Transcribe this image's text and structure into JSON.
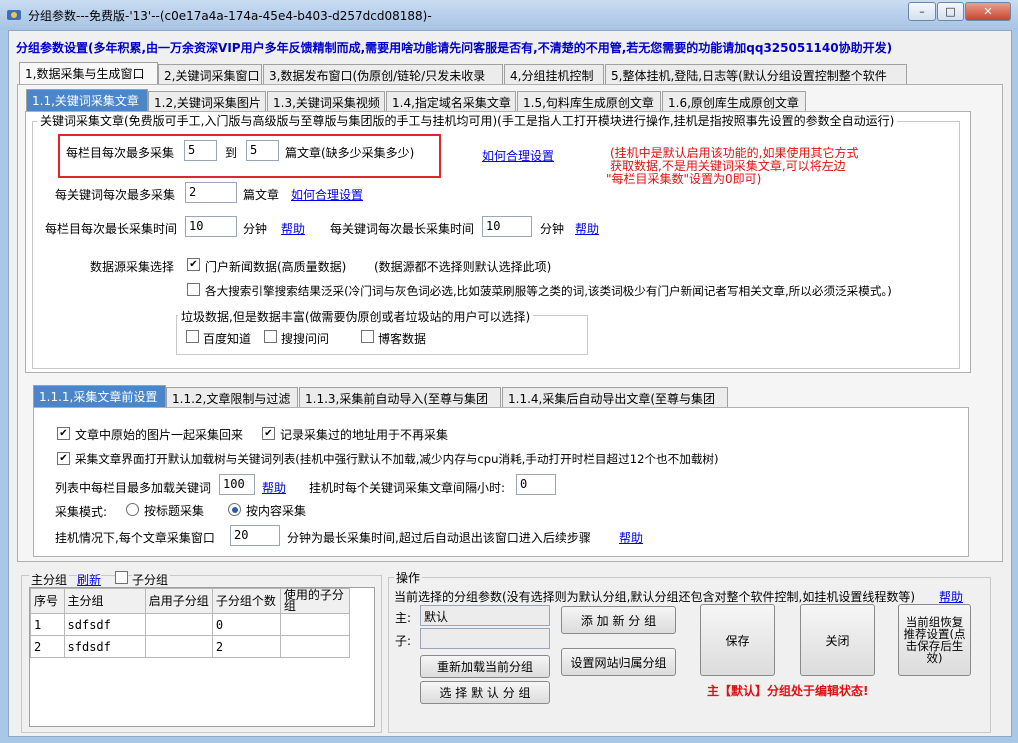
{
  "window": {
    "title": "分组参数---免费版-'13'--(c0e17a4a-174a-45e4-b403-d257dcd08188)-",
    "controls": {
      "minimize": "–",
      "maximize": "□",
      "close": "✕"
    }
  },
  "banner": "分组参数设置(多年积累,由一万余资深VIP用户多年反馈精制而成,需要用啥功能请先问客服是否有,不清楚的不用管,若无您需要的功能请加qq325051140协助开发)",
  "main_tabs": [
    "1,数据采集与生成窗口",
    "2,关键词采集窗口",
    "3,数据发布窗口(伪原创/链轮/只发未收录",
    "4,分组挂机控制",
    "5,整体挂机,登陆,日志等(默认分组设置控制整个软件"
  ],
  "sub_tabs": [
    "1.1,关键词采集文章",
    "1.2,关键词采集图片",
    "1.3,关键词采集视频",
    "1.4,指定域名采集文章",
    "1.5,句料库生成原创文章",
    "1.6,原创库生成原创文章"
  ],
  "section1": {
    "group_title": "关键词采集文章(免费版可手工,入门版与高级版与至尊版与集团版的手工与挂机均可用)(手工是指人工打开模块进行操作,挂机是指按照事先设置的参数全自动运行)",
    "per_col_label": "每栏目每次最多采集",
    "per_col_min": "5",
    "to_label": "到",
    "per_col_max": "5",
    "per_col_unit": "篇文章(缺多少采集多少)",
    "how_link": "如何合理设置",
    "red_note": [
      "(挂机中是默认启用该功能的,如果使用其它方式",
      "获取数据,不是用关键词采集文章,可以将左边",
      "\"每栏目采集数\"设置为0即可)"
    ],
    "per_kw_label": "每关键词每次最多采集",
    "per_kw_value": "2",
    "per_kw_unit": "篇文章",
    "per_kw_link": "如何合理设置",
    "col_time_label": "每栏目每次最长采集时间",
    "col_time_value": "10",
    "col_time_unit": "分钟",
    "col_time_help": "帮助",
    "kw_time_label": "每关键词每次最长采集时间",
    "kw_time_value": "10",
    "kw_time_unit": "分钟",
    "kw_time_help": "帮助",
    "source_label": "数据源采集选择",
    "source_portal": "门户新闻数据(高质量数据)",
    "source_portal_note": "(数据源都不选择则默认选择此项)",
    "source_portal_checked": true,
    "source_search": "各大搜索引擎搜索结果泛采(冷门词与灰色词必选,比如菠菜刷服等之类的词,该类词极少有门户新闻记者写相关文章,所以必须泛采模式。)",
    "source_search_checked": false,
    "junk_title": "垃圾数据,但是数据丰富(做需要伪原创或者垃圾站的用户可以选择)",
    "junk_items": [
      {
        "label": "百度知道",
        "checked": false
      },
      {
        "label": "搜搜问问",
        "checked": false
      },
      {
        "label": "博客数据",
        "checked": false
      }
    ]
  },
  "inner_tabs": [
    "1.1.1,采集文章前设置",
    "1.1.2,文章限制与过滤",
    "1.1.3,采集前自动导入(至尊与集团",
    "1.1.4,采集后自动导出文章(至尊与集团"
  ],
  "section2": {
    "img_collect": "文章中原始的图片一起采集回来",
    "img_collect_checked": true,
    "record_url": "记录采集过的地址用于不再采集",
    "record_url_checked": true,
    "load_tree": "采集文章界面打开默认加载树与关键词列表(挂机中强行默认不加载,减少内存与cpu消耗,手动打开时栏目超过12个也不加载树)",
    "load_tree_checked": true,
    "max_kw_label": "列表中每栏目最多加载关键词",
    "max_kw_value": "100",
    "max_kw_help": "帮助",
    "interval_label": "挂机时每个关键词采集文章间隔小时:",
    "interval_value": "0",
    "mode_label": "采集模式:",
    "mode_title": "按标题采集",
    "mode_content": "按内容采集",
    "mode_selected": "content",
    "timeout_label": "挂机情况下,每个文章采集窗口",
    "timeout_value": "20",
    "timeout_suffix": "分钟为最长采集时间,超过后自动退出该窗口进入后续步骤",
    "timeout_help": "帮助"
  },
  "groups": {
    "title": "主分组",
    "refresh": "刷新",
    "sub_group_label": "子分组",
    "sub_group_checked": false,
    "columns": [
      "序号",
      "主分组",
      "启用子分组",
      "子分组个数",
      "使用的子分组"
    ],
    "rows": [
      [
        "1",
        "sdfsdf",
        "",
        "0",
        ""
      ],
      [
        "2",
        "sfdsdf",
        "",
        "2",
        ""
      ]
    ]
  },
  "ops": {
    "title": "操作",
    "desc": "当前选择的分组参数(没有选择则为默认分组,默认分组还包含对整个软件控制,如挂机设置线程数等)",
    "help": "帮助",
    "main_label": "主:",
    "main_value": "默认",
    "sub_label": "子:",
    "sub_value": "",
    "add_group": "添 加 新 分 组",
    "reload": "重新加载当前分组",
    "site_group": "设置网站归属分组",
    "select_default": "选 择 默 认 分 组",
    "save": "保存",
    "close": "关闭",
    "restore": "当前组恢复推荐设置(点击保存后生效)",
    "status": "主【默认】分组处于编辑状态!"
  }
}
